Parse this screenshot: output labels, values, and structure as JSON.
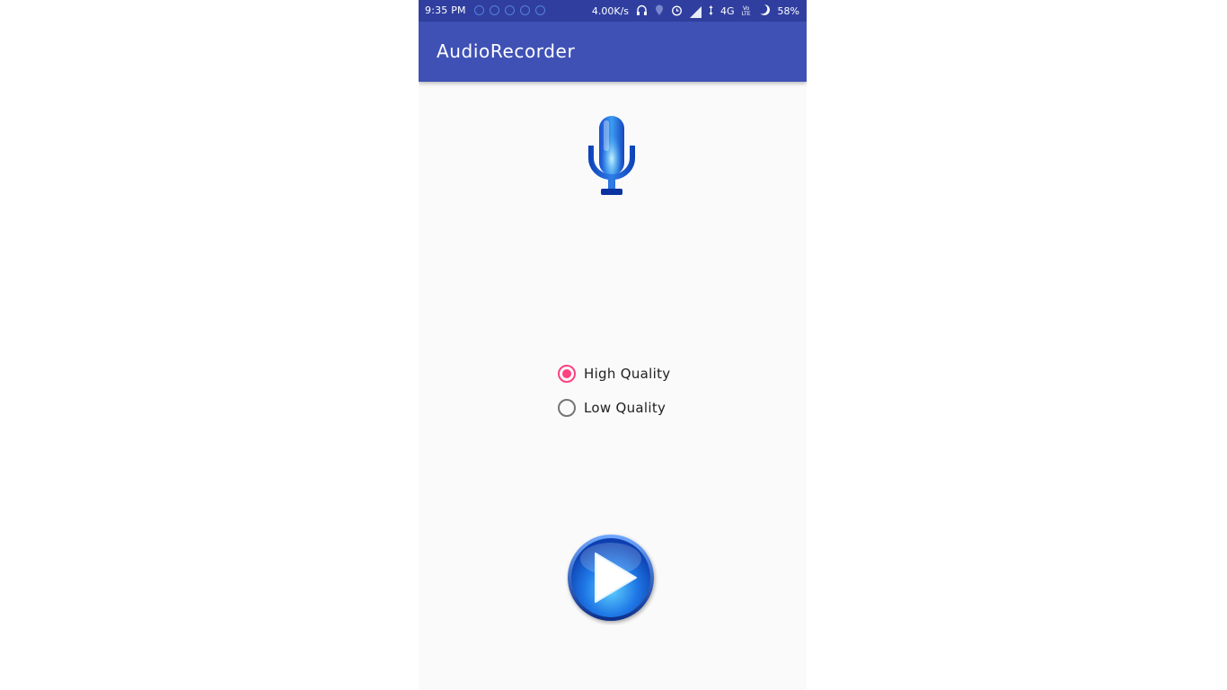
{
  "status_bar": {
    "time": "9:35 PM",
    "network_speed": "4.00K/s",
    "network_type": "4G",
    "volte_top": "Vo",
    "volte_bottom": "LTE",
    "battery": "58%"
  },
  "app_bar": {
    "title": "AudioRecorder"
  },
  "quality_options": [
    {
      "label": "High Quality",
      "checked": true
    },
    {
      "label": "Low Quality",
      "checked": false
    }
  ],
  "colors": {
    "status_bar": "#303f9f",
    "app_bar": "#3f51b5",
    "accent": "#ff4081",
    "background": "#fafafa"
  },
  "icons": {
    "record": "microphone-icon",
    "play": "play-icon"
  }
}
